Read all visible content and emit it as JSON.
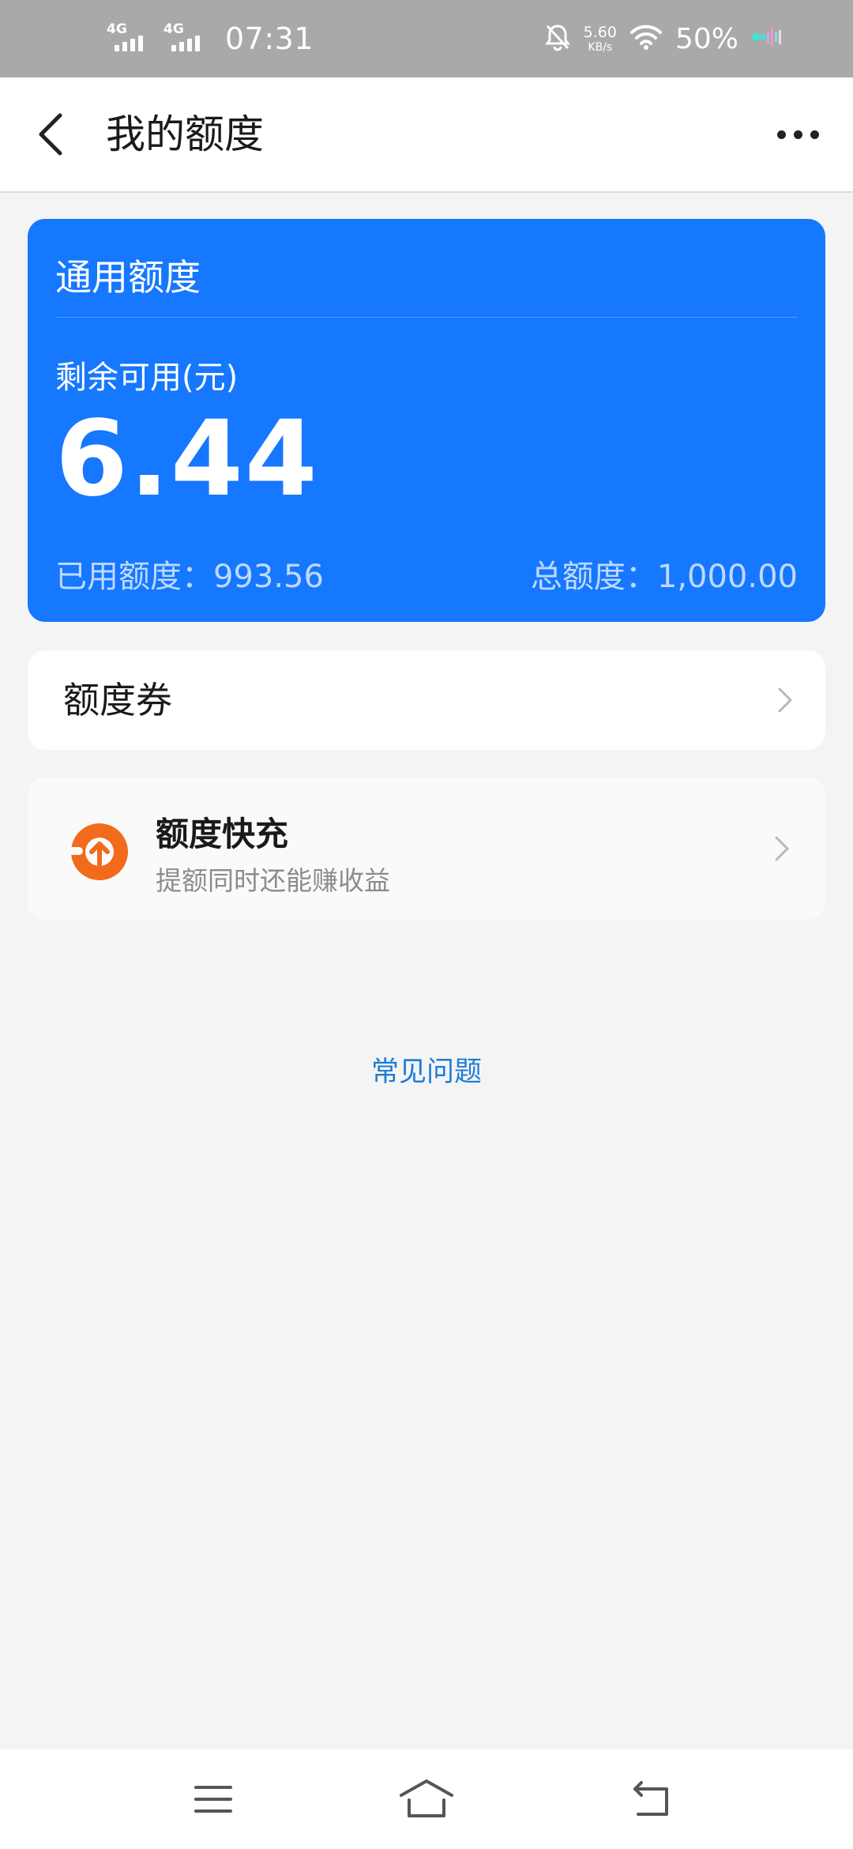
{
  "status_bar": {
    "sim1_network": "4G",
    "sim2_network": "4G",
    "time": "07:31",
    "net_speed_value": "5.60",
    "net_speed_unit": "KB/s",
    "battery": "50%"
  },
  "header": {
    "title": "我的额度"
  },
  "quota_card": {
    "title": "通用额度",
    "remaining_label": "剩余可用(元)",
    "remaining_amount": "6.44",
    "used_text": "已用额度：993.56",
    "total_text": "总额度：1,000.00",
    "color": "#1677ff"
  },
  "coupon_row": {
    "label": "额度券"
  },
  "recharge_row": {
    "title": "额度快充",
    "subtitle": "提额同时还能赚收益",
    "icon_color": "#f26a1b"
  },
  "faq": {
    "label": "常见问题"
  },
  "icons": {
    "back": "back-arrow-icon",
    "more": "more-dots-icon",
    "chevron": "chevron-right-icon",
    "nav_menu": "menu-lines-icon",
    "nav_home": "home-icon",
    "nav_back": "return-icon"
  }
}
